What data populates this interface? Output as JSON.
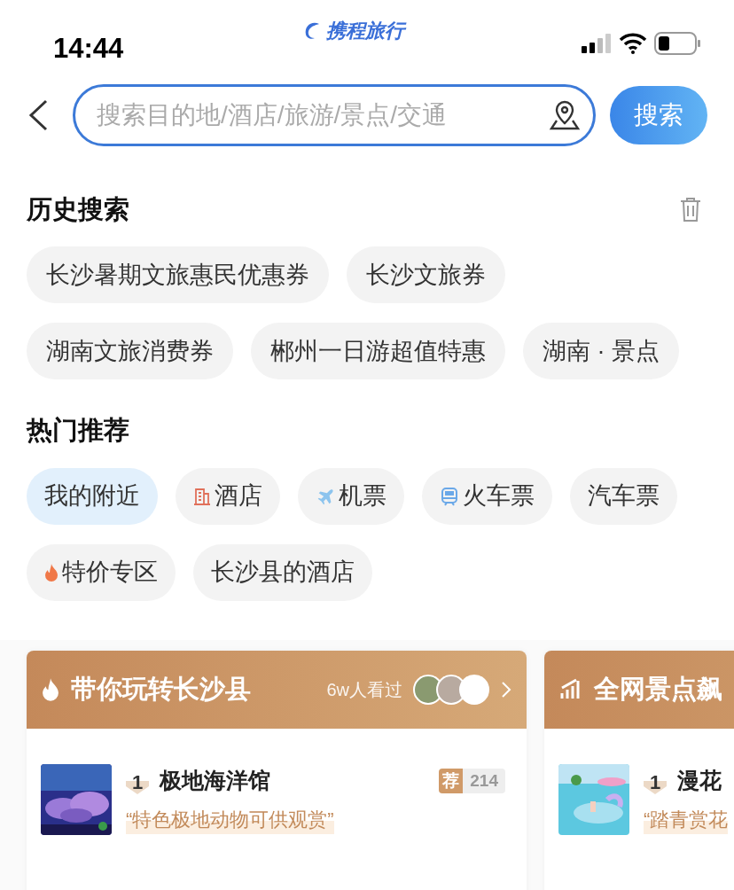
{
  "status_bar": {
    "time": "14:44",
    "brand": "携程旅行"
  },
  "search": {
    "placeholder": "搜索目的地/酒店/旅游/景点/交通",
    "button": "搜索"
  },
  "history": {
    "title": "历史搜索",
    "items": [
      "长沙暑期文旅惠民优惠券",
      "长沙文旅券",
      "湖南文旅消费券",
      "郴州一日游超值特惠",
      "湖南 · 景点"
    ]
  },
  "hot": {
    "title": "热门推荐",
    "items": [
      {
        "label": "我的附近",
        "kind": "plain",
        "selected": true
      },
      {
        "label": "酒店",
        "kind": "hotel",
        "selected": false
      },
      {
        "label": "机票",
        "kind": "plane",
        "selected": false
      },
      {
        "label": "火车票",
        "kind": "train",
        "selected": false
      },
      {
        "label": "汽车票",
        "kind": "plain",
        "selected": false
      },
      {
        "label": "特价专区",
        "kind": "fire",
        "selected": false
      },
      {
        "label": "长沙县的酒店",
        "kind": "plain",
        "selected": false
      }
    ]
  },
  "cards": [
    {
      "kind": "fire",
      "title": "带你玩转长沙县",
      "views": "6w人看过",
      "avatars": [
        {
          "kind": "picture"
        },
        {
          "kind": "picture"
        },
        {
          "kind": "picture"
        }
      ],
      "items": [
        {
          "rank": "1",
          "name": "极地海洋馆",
          "quote": "“特色极地动物可供观赏”",
          "badge": "荐",
          "count": "214",
          "photo": {
            "kind": "picture"
          }
        }
      ]
    },
    {
      "kind": "chart",
      "title": "全网景点飙",
      "items": [
        {
          "rank": "1",
          "name": "漫花",
          "quote": "“踏青赏花",
          "photo": {
            "kind": "picture"
          }
        }
      ]
    }
  ]
}
